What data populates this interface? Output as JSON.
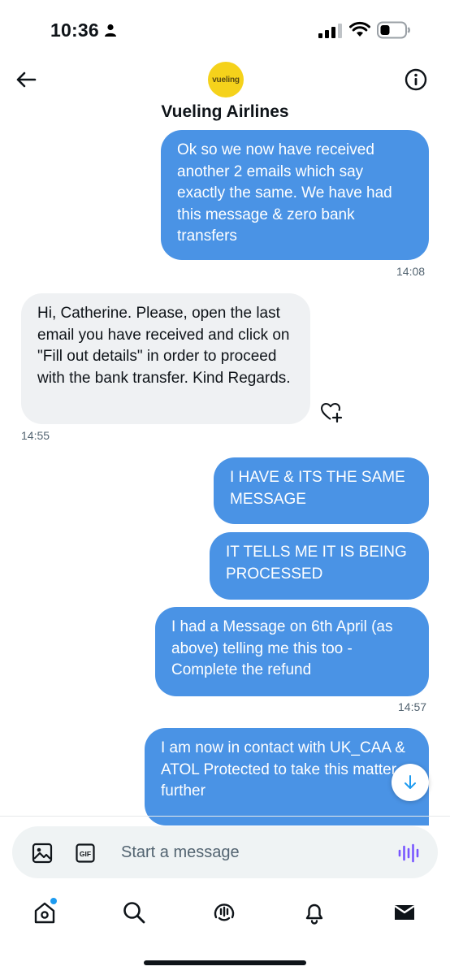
{
  "status_bar": {
    "time": "10:36"
  },
  "header": {
    "avatar_text": "vueling",
    "contact_name": "Vueling Airlines"
  },
  "messages": [
    {
      "text": "Ok so we now have received another 2 emails which say exactly the same. We have had this message & zero bank transfers",
      "from": "me",
      "time": "14:08"
    },
    {
      "text": "Hi, Catherine. Please, open the last email you have received and click on \"Fill out details\" in order to proceed with the bank transfer. Kind Regards.",
      "from": "them",
      "time": "14:55"
    },
    {
      "text": "I HAVE & ITS THE SAME MESSAGE",
      "from": "me"
    },
    {
      "text": "IT TELLS ME IT IS BEING PROCESSED",
      "from": "me"
    },
    {
      "text": "I had a Message on 6th April (as above) telling me this too - Complete the refund",
      "from": "me",
      "time": "14:57"
    },
    {
      "text": "I am now in contact with UK_CAA & ATOL Protected to take this matter further",
      "from": "me"
    }
  ],
  "composer": {
    "placeholder": "Start a message",
    "gif_label": "GIF"
  },
  "colors": {
    "sent_bubble": "#4a93e5",
    "received_bubble": "#eff1f3",
    "accent": "#1d9bf0",
    "voice": "#7856ff",
    "avatar": "#f5d21b"
  },
  "tabs": [
    "home-icon",
    "search-icon",
    "spaces-icon",
    "bell-icon",
    "mail-icon"
  ]
}
